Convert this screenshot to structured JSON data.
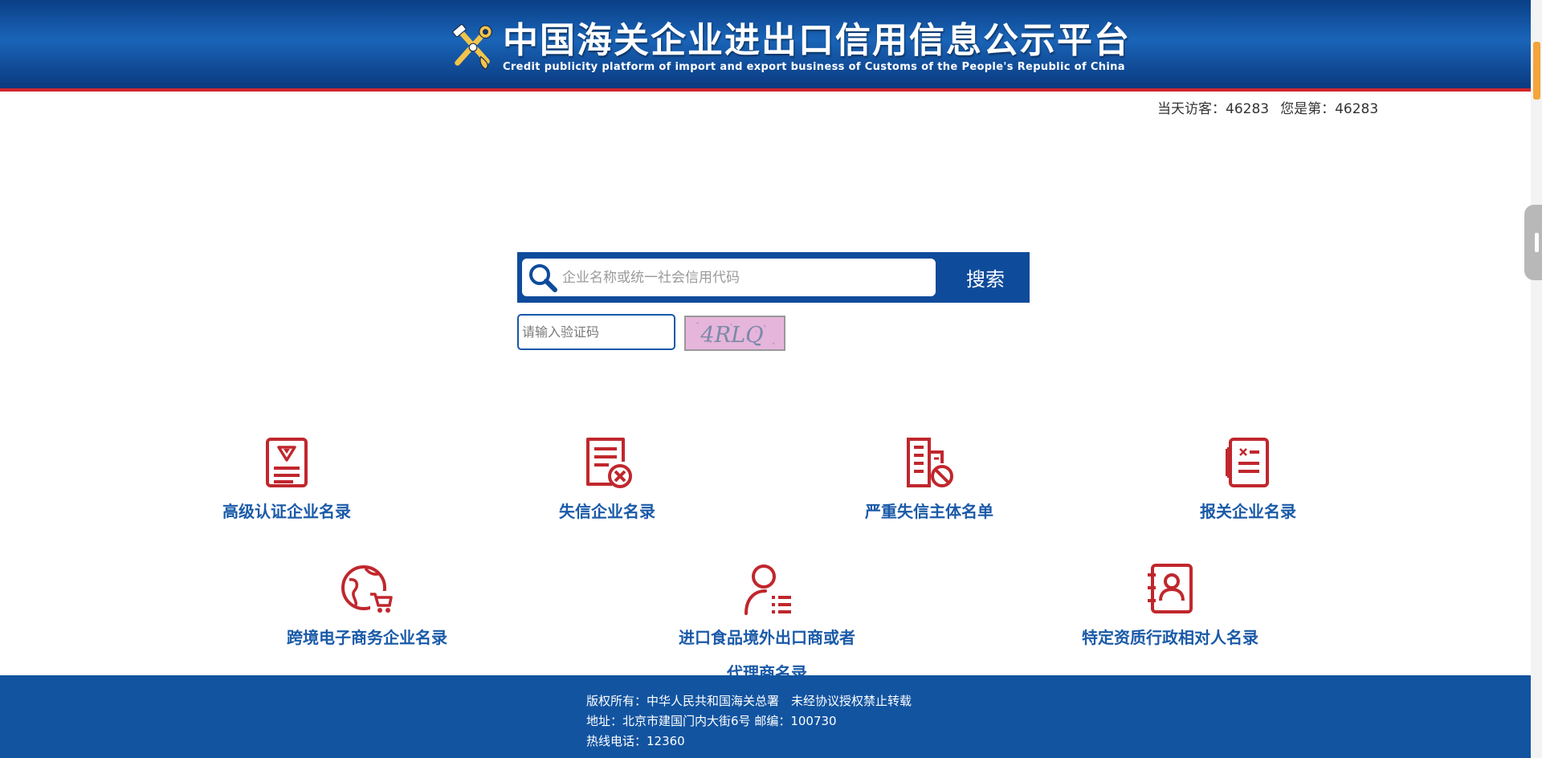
{
  "header": {
    "title_zh": "中国海关企业进出口信用信息公示平台",
    "title_en": "Credit publicity platform of import and export business of Customs of the People's Republic of China",
    "logo_icon": "customs-emblem-icon"
  },
  "visitor": {
    "today": "当天访客：46283",
    "rank": "您是第：46283"
  },
  "search": {
    "placeholder": "企业名称或统一社会信用代码",
    "button_label": "搜索",
    "captcha_placeholder": "请输入验证码",
    "captcha_text": "4RLQ"
  },
  "categories": [
    {
      "label": "高级认证企业名录",
      "icon": "certificate-icon"
    },
    {
      "label": "失信企业名录",
      "icon": "document-x-icon"
    },
    {
      "label": "严重失信主体名单",
      "icon": "building-ban-icon"
    },
    {
      "label": "报关企业名录",
      "icon": "notebook-icon"
    },
    {
      "label": "跨境电子商务企业名录",
      "icon": "globe-cart-icon"
    },
    {
      "label": "进口食品境外出口商或者",
      "label2": "代理商名录",
      "icon": "person-list-icon"
    },
    {
      "label": "特定资质行政相对人名录",
      "icon": "contact-book-icon"
    }
  ],
  "footer": {
    "copyright": "版权所有：中华人民共和国海关总署　未经协议授权禁止转载",
    "address": "地址：北京市建国门内大街6号 邮编：100730",
    "hotline": "热线电话：12360"
  },
  "colors": {
    "header_blue": "#1558a8",
    "accent_red": "#d1262c",
    "icon_red": "#c0272d",
    "label_blue": "#1a5aa8",
    "footer_blue": "#1254a0"
  }
}
